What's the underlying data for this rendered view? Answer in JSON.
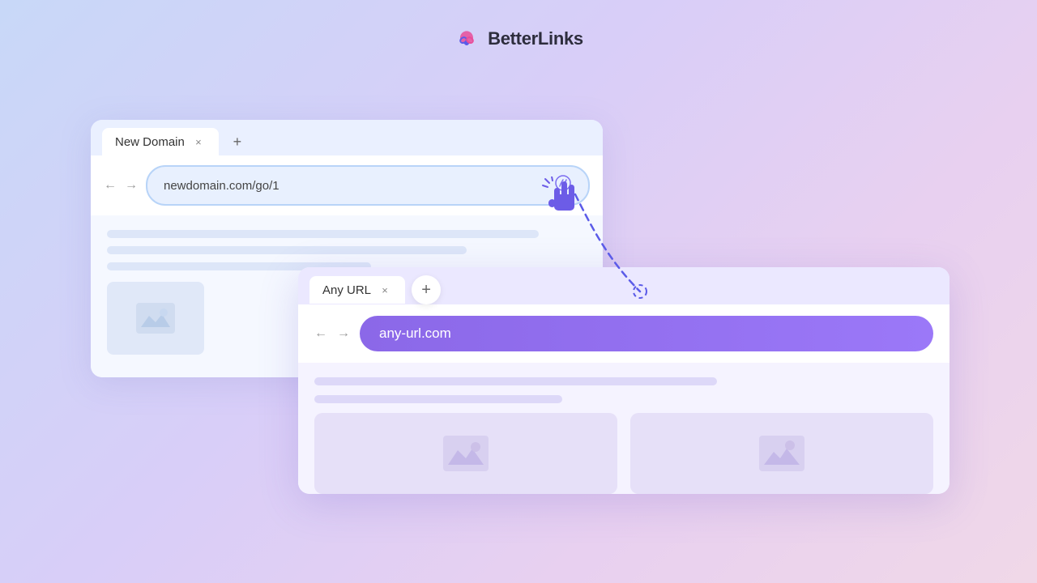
{
  "header": {
    "logo_text": "BetterLinks"
  },
  "browser1": {
    "tab_label": "New Domain",
    "tab_close": "×",
    "tab_add": "+",
    "nav_back": "←",
    "nav_forward": "→",
    "address_url": "newdomain.com/go/1",
    "address_icon": "✦"
  },
  "browser2": {
    "tab_label": "Any URL",
    "tab_close": "×",
    "tab_add": "+",
    "nav_back": "←",
    "nav_forward": "→",
    "address_url": "any-url.com"
  },
  "icons": {
    "mountain_symbol": "🏔",
    "image_symbol": "⛰"
  }
}
